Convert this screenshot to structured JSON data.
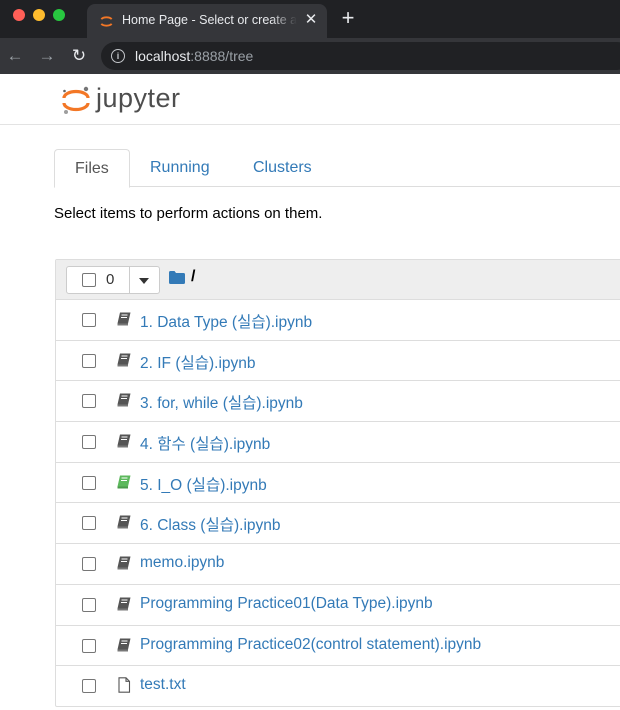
{
  "browser": {
    "tab_title": "Home Page - Select or create a notebook",
    "url_host": "localhost",
    "url_rest": ":8888/tree",
    "colors": {
      "chrome_dark": "#202124",
      "tab": "#35363a"
    }
  },
  "jupyter": {
    "logo_text": "jupyter",
    "tabs": [
      {
        "label": "Files",
        "active": true
      },
      {
        "label": "Running",
        "active": false
      },
      {
        "label": "Clusters",
        "active": false
      }
    ],
    "hint": "Select items to perform actions on them.",
    "selected_count": "0",
    "current_path": "/",
    "items": [
      {
        "name": "1. Data Type (실습).ipynb",
        "type": "notebook",
        "running": false
      },
      {
        "name": "2. IF (실습).ipynb",
        "type": "notebook",
        "running": false
      },
      {
        "name": "3. for, while (실습).ipynb",
        "type": "notebook",
        "running": false
      },
      {
        "name": "4. 함수 (실습).ipynb",
        "type": "notebook",
        "running": false
      },
      {
        "name": "5. I_O (실습).ipynb",
        "type": "notebook",
        "running": true
      },
      {
        "name": "6. Class (실습).ipynb",
        "type": "notebook",
        "running": false
      },
      {
        "name": "memo.ipynb",
        "type": "notebook",
        "running": false
      },
      {
        "name": "Programming Practice01(Data Type).ipynb",
        "type": "notebook",
        "running": false
      },
      {
        "name": "Programming Practice02(control statement).ipynb",
        "type": "notebook",
        "running": false
      },
      {
        "name": "test.txt",
        "type": "file",
        "running": false
      }
    ],
    "colors": {
      "link": "#337ab7",
      "running_notebook": "#5cb85c",
      "notebook_icon": "#555555",
      "logo_orange": "#f37726"
    }
  }
}
